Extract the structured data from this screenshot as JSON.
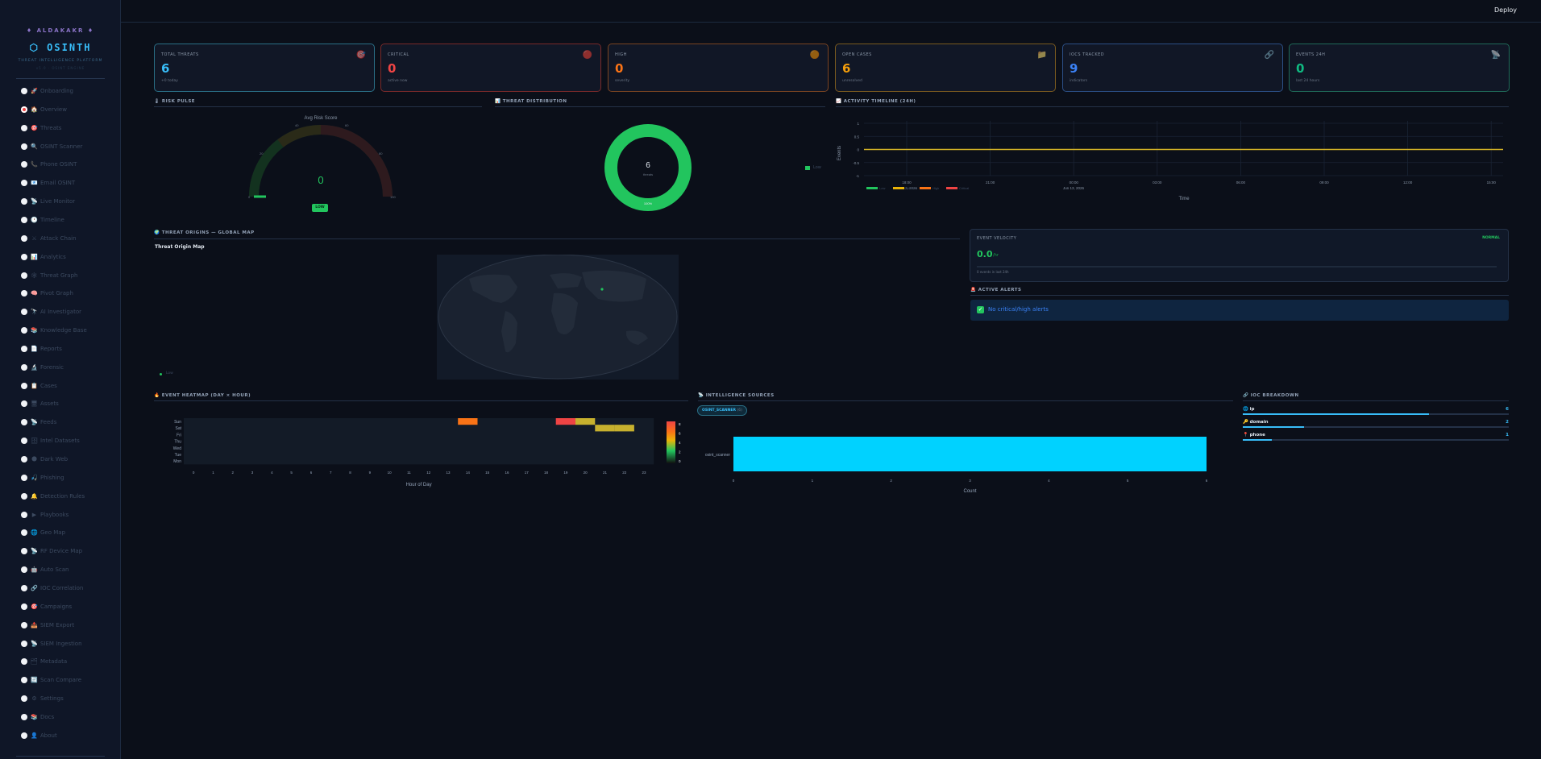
{
  "brand": {
    "tag": "♦ ALDAKAKR ♦",
    "name": "⬡ OSINTH",
    "subtitle": "THREAT INTELLIGENCE PLATFORM",
    "subtitle2": "v5.0 · OSINT ENGINE"
  },
  "topbar": {
    "deploy_label": "Deploy"
  },
  "nav": [
    {
      "icon": "🚀",
      "label": "Onboarding"
    },
    {
      "icon": "🏠",
      "label": "Overview",
      "selected": true
    },
    {
      "icon": "🎯",
      "label": "Threats"
    },
    {
      "icon": "🔍",
      "label": "OSINT Scanner"
    },
    {
      "icon": "📞",
      "label": "Phone OSINT"
    },
    {
      "icon": "📧",
      "label": "Email OSINT"
    },
    {
      "icon": "📡",
      "label": "Live Monitor"
    },
    {
      "icon": "🕐",
      "label": "Timeline"
    },
    {
      "icon": "⚔",
      "label": "Attack Chain"
    },
    {
      "icon": "📊",
      "label": "Analytics"
    },
    {
      "icon": "🕸",
      "label": "Threat Graph"
    },
    {
      "icon": "🧠",
      "label": "Pivot Graph"
    },
    {
      "icon": "🔭",
      "label": "AI Investigator"
    },
    {
      "icon": "📚",
      "label": "Knowledge Base"
    },
    {
      "icon": "📄",
      "label": "Reports"
    },
    {
      "icon": "🔬",
      "label": "Forensic"
    },
    {
      "icon": "📋",
      "label": "Cases"
    },
    {
      "icon": "🖥",
      "label": "Assets"
    },
    {
      "icon": "📡",
      "label": "Feeds"
    },
    {
      "icon": "🗄",
      "label": "Intel Datasets"
    },
    {
      "icon": "🌑",
      "label": "Dark Web"
    },
    {
      "icon": "🎣",
      "label": "Phishing"
    },
    {
      "icon": "🔔",
      "label": "Detection Rules"
    },
    {
      "icon": "▶",
      "label": "Playbooks"
    },
    {
      "icon": "🌐",
      "label": "Geo Map"
    },
    {
      "icon": "📡",
      "label": "RF Device Map"
    },
    {
      "icon": "🤖",
      "label": "Auto Scan"
    },
    {
      "icon": "🔗",
      "label": "IOC Correlation"
    },
    {
      "icon": "🎯",
      "label": "Campaigns"
    },
    {
      "icon": "📤",
      "label": "SIEM Export"
    },
    {
      "icon": "📡",
      "label": "SIEM Ingestion"
    },
    {
      "icon": "🗂",
      "label": "Metadata"
    },
    {
      "icon": "🔄",
      "label": "Scan Compare"
    },
    {
      "icon": "⚙",
      "label": "Settings"
    },
    {
      "icon": "📚",
      "label": "Docs"
    },
    {
      "icon": "👤",
      "label": "About"
    }
  ],
  "cards": [
    {
      "label": "TOTAL THREATS",
      "value": "6",
      "sub": "+0 today",
      "icon": "🎯",
      "color": "#38bdf8",
      "border": "#2a6f86"
    },
    {
      "label": "CRITICAL",
      "value": "0",
      "sub": "active now",
      "icon": "🔴",
      "color": "#ef4444",
      "border": "#7a2a2a"
    },
    {
      "label": "HIGH",
      "value": "0",
      "sub": "severity",
      "icon": "🟠",
      "color": "#f97316",
      "border": "#7a4422"
    },
    {
      "label": "OPEN CASES",
      "value": "6",
      "sub": "unresolved",
      "icon": "📁",
      "color": "#f59e0b",
      "border": "#7a5a1f"
    },
    {
      "label": "IOCS TRACKED",
      "value": "9",
      "sub": "indicators",
      "icon": "🔗",
      "color": "#3b82f6",
      "border": "#2b4f86"
    },
    {
      "label": "EVENTS 24H",
      "value": "0",
      "sub": "last 24 hours",
      "icon": "📡",
      "color": "#10b981",
      "border": "#1f6a58"
    }
  ],
  "sections": {
    "risk": "🌡 RISK PULSE",
    "dist": "📊 THREAT DISTRIBUTION",
    "timeline": "📈 ACTIVITY TIMELINE (24H)",
    "map": "🌍 THREAT ORIGINS — GLOBAL MAP",
    "heatmap": "🔥 EVENT HEATMAP (DAY × HOUR)",
    "sources": "📡 INTELLIGENCE SOURCES",
    "ioc": "🔗 IOC BREAKDOWN",
    "alerts": "🚨 ACTIVE ALERTS"
  },
  "gauge": {
    "title": "Avg Risk Score",
    "value": "0",
    "badge": "LOW",
    "ticks": [
      "0",
      "20",
      "40",
      "60",
      "80",
      "100"
    ]
  },
  "donut": {
    "total": "6",
    "total_label": "threats",
    "pct": "100%",
    "legend": "Low",
    "color": "#22c55e"
  },
  "timeline": {
    "ylabel": "Events",
    "xlabel": "Time",
    "yticks": [
      "1",
      "0.5",
      "0",
      "-0.5",
      "-1"
    ],
    "xticks": [
      "18:00",
      "21:00",
      "00:00",
      "03:00",
      "06:00",
      "09:00",
      "12:00",
      "15:00"
    ],
    "xsub": "Jun 12, 2026",
    "xsub2": "Jun 13, 2026",
    "legend": [
      "Low",
      "Medium",
      "High",
      "Critical"
    ]
  },
  "map": {
    "title": "Threat Origin Map",
    "legend": "Low"
  },
  "velocity": {
    "label": "EVENT VELOCITY",
    "status": "NORMAL",
    "value": "0.0",
    "unit": "/hr",
    "sub": "0 events in last 24h"
  },
  "alerts": {
    "text": "No critical/high alerts"
  },
  "heatmap": {
    "days": [
      "Sun",
      "Sat",
      "Fri",
      "Thu",
      "Wed",
      "Tue",
      "Mon"
    ],
    "hours": [
      "0",
      "1",
      "2",
      "3",
      "4",
      "5",
      "6",
      "7",
      "8",
      "9",
      "10",
      "11",
      "12",
      "13",
      "14",
      "15",
      "16",
      "17",
      "18",
      "19",
      "20",
      "21",
      "22",
      "23"
    ],
    "xlabel": "Hour of Day",
    "scale": [
      "0",
      "2",
      "4",
      "6",
      "8"
    ],
    "cells": [
      {
        "day": 0,
        "hour": 14,
        "v": 6
      },
      {
        "day": 0,
        "hour": 19,
        "v": 8
      },
      {
        "day": 0,
        "hour": 20,
        "v": 5
      },
      {
        "day": 1,
        "hour": 21,
        "v": 4
      },
      {
        "day": 1,
        "hour": 22,
        "v": 4
      }
    ]
  },
  "sources": {
    "badge": "OSINT_SCANNER",
    "badge_count": "(6)",
    "category": "osint_scanner",
    "value": 6,
    "xticks": [
      "0",
      "1",
      "2",
      "3",
      "4",
      "5",
      "6"
    ],
    "xlabel": "Count"
  },
  "ioc": [
    {
      "icon": "🌐",
      "label": "ip",
      "count": "6",
      "frac": 0.7
    },
    {
      "icon": "🔑",
      "label": "domain",
      "count": "2",
      "frac": 0.23
    },
    {
      "icon": "📍",
      "label": "phone",
      "count": "1",
      "frac": 0.11
    }
  ]
}
